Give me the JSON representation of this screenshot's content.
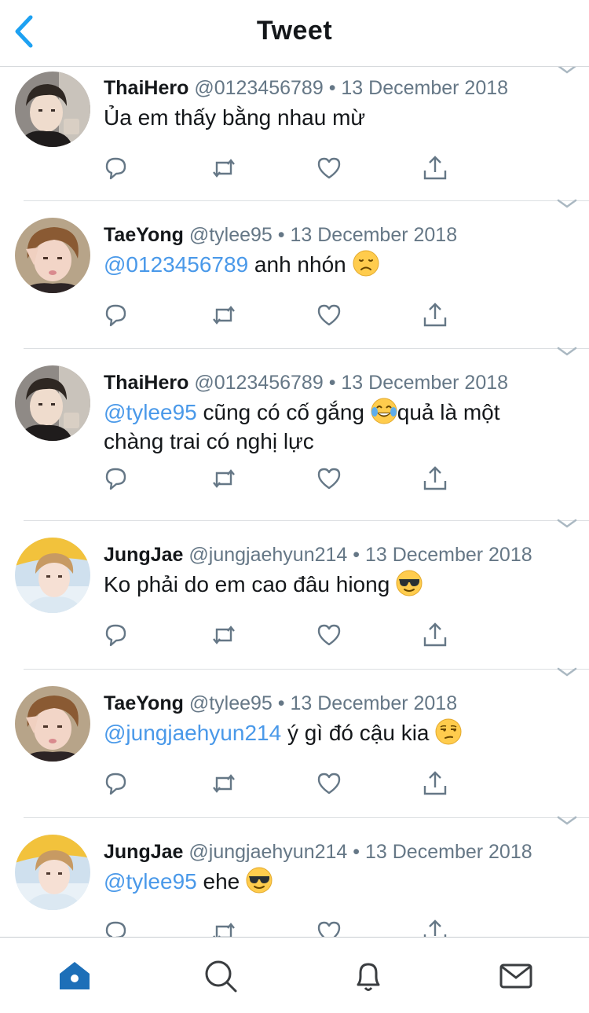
{
  "header": {
    "title": "Tweet"
  },
  "tweets": [
    {
      "name": "ThaiHero",
      "handle": "@0123456789",
      "dot": "•",
      "date": "13 December 2018",
      "avatar": "avatar-thaihero",
      "text_parts": [
        {
          "text": "Ủa em thấy bằng nhau mừ"
        }
      ]
    },
    {
      "name": "TaeYong",
      "handle": "@tylee95",
      "dot": "•",
      "date": "13 December 2018",
      "avatar": "avatar-taeyong",
      "text_parts": [
        {
          "text": "@0123456789",
          "mention": true
        },
        {
          "text": " anh nhón "
        },
        {
          "emoji": "disappointed-face-emoji"
        }
      ]
    },
    {
      "name": "ThaiHero",
      "handle": "@0123456789",
      "dot": "•",
      "date": "13 December 2018",
      "avatar": "avatar-thaihero",
      "text_parts": [
        {
          "text": "@tylee95",
          "mention": true
        },
        {
          "text": " cũng có cố gắng "
        },
        {
          "emoji": "tears-of-joy-emoji"
        },
        {
          "text": "quả là một chàng trai có nghị lực"
        }
      ]
    },
    {
      "name": "JungJae",
      "handle": "@jungjaehyun214",
      "dot": "•",
      "date": "13 December 2018",
      "avatar": "avatar-jungjae",
      "text_parts": [
        {
          "text": "Ko phải do em cao đâu hiong "
        },
        {
          "emoji": "sunglasses-face-emoji"
        }
      ]
    },
    {
      "name": "TaeYong",
      "handle": "@tylee95",
      "dot": "•",
      "date": "13 December 2018",
      "avatar": "avatar-taeyong",
      "text_parts": [
        {
          "text": "@jungjaehyun214",
          "mention": true
        },
        {
          "text": " ý gì đó cậu kia "
        },
        {
          "emoji": "unamused-face-emoji"
        }
      ]
    },
    {
      "name": "JungJae",
      "handle": "@jungjaehyun214",
      "dot": "•",
      "date": "13 December 2018",
      "avatar": "avatar-jungjae",
      "text_parts": [
        {
          "text": "@tylee95",
          "mention": true
        },
        {
          "text": " ehe "
        },
        {
          "emoji": "sunglasses-face-emoji"
        }
      ]
    }
  ],
  "tweet_actions": [
    "reply-icon",
    "retweet-icon",
    "like-icon",
    "share-icon"
  ],
  "tabbar": {
    "tabs": [
      "home-icon",
      "search-icon",
      "notifications-icon",
      "messages-icon"
    ],
    "active": "home-icon"
  },
  "colors": {
    "accent": "#1da1f2",
    "mention": "#4a99e9",
    "secondary_text": "#657786",
    "tab_active": "#1d6fb8",
    "tab_inactive": "#3a3d40"
  }
}
